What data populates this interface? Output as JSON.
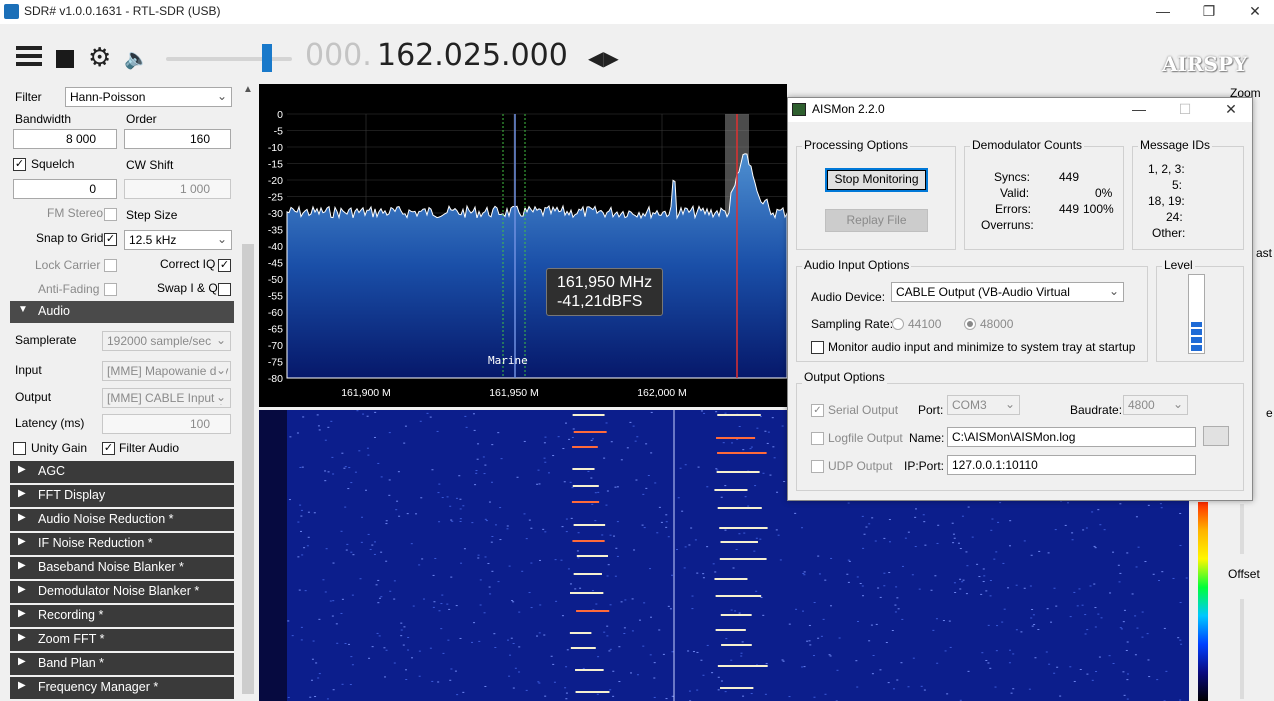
{
  "window": {
    "title": "SDR# v1.0.0.1631 - RTL-SDR (USB)"
  },
  "toolbar": {
    "freq_dim": "000.",
    "freq_main": "162.025.000",
    "logo": "AIRSPY",
    "volume_level": 0.8
  },
  "left": {
    "filter_label": "Filter",
    "filter_value": "Hann-Poisson",
    "bandwidth_label": "Bandwidth",
    "bandwidth_value": "8 000",
    "order_label": "Order",
    "order_value": "160",
    "squelch_label": "Squelch",
    "squelch_value": "0",
    "cwshift_label": "CW Shift",
    "cwshift_value": "1 000",
    "fmstereo_label": "FM Stereo",
    "stepsize_label": "Step Size",
    "stepsize_value": "12.5 kHz",
    "snap_label": "Snap to Grid",
    "correctiq_label": "Correct IQ",
    "lockcarrier_label": "Lock Carrier",
    "swapiq_label": "Swap I & Q",
    "antifading_label": "Anti-Fading",
    "audio": {
      "title": "Audio",
      "samplerate_label": "Samplerate",
      "samplerate_value": "192000 sample/sec",
      "input_label": "Input",
      "input_value": "[MME] Mapowanie dźv",
      "output_label": "Output",
      "output_value": "[MME] CABLE Input (\\",
      "latency_label": "Latency (ms)",
      "latency_value": "100",
      "unity_label": "Unity Gain",
      "filteraudio_label": "Filter Audio"
    },
    "sections": [
      "AGC",
      "FFT Display",
      "Audio Noise Reduction *",
      "IF Noise Reduction *",
      "Baseband Noise Blanker *",
      "Demodulator Noise Blanker *",
      "Recording *",
      "Zoom FFT *",
      "Band Plan *",
      "Frequency Manager *"
    ]
  },
  "spectrum": {
    "y_ticks": [
      "0",
      "-5",
      "-10",
      "-15",
      "-20",
      "-25",
      "-30",
      "-35",
      "-40",
      "-45",
      "-50",
      "-55",
      "-60",
      "-65",
      "-70",
      "-75",
      "-80"
    ],
    "x_ticks": [
      "161,900 M",
      "161,950 M",
      "162,000 M"
    ],
    "marker": "Marine",
    "tooltip_freq": "161,950 MHz",
    "tooltip_level": "-41,21dBFS"
  },
  "right": {
    "zoom_label": "Zoom",
    "contrast_label": "ast",
    "range_label": "e",
    "offset_label": "Offset"
  },
  "aismon": {
    "title": "AISMon 2.2.0",
    "processing_title": "Processing Options",
    "stop_button": "Stop Monitoring",
    "replay_button": "Replay File",
    "demod_title": "Demodulator Counts",
    "syncs_label": "Syncs:",
    "syncs_value": "449",
    "valid_label": "Valid:",
    "valid_pct": "0%",
    "errors_label": "Errors:",
    "errors_value": "449",
    "errors_pct": "100%",
    "overruns_label": "Overruns:",
    "msgids_title": "Message IDs",
    "msgids": [
      "1, 2, 3:",
      "5:",
      "18, 19:",
      "24:",
      "Other:"
    ],
    "audio_title": "Audio Input Options",
    "device_label": "Audio Device:",
    "device_value": "CABLE Output (VB-Audio Virtual",
    "rate_label": "Sampling Rate:",
    "rate_a": "44100",
    "rate_b": "48000",
    "monitor_label": "Monitor audio input and minimize to system tray at startup",
    "level_title": "Level",
    "level_value": 0.38,
    "output_title": "Output Options",
    "serial_label": "Serial Output",
    "port_label": "Port:",
    "port_value": "COM3",
    "baud_label": "Baudrate:",
    "baud_value": "4800",
    "logfile_label": "Logfile Output",
    "name_label": "Name:",
    "name_value": "C:\\AISMon\\AISMon.log",
    "udp_label": "UDP Output",
    "ipport_label": "IP:Port:",
    "ipport_value": "127.0.0.1:10110"
  }
}
